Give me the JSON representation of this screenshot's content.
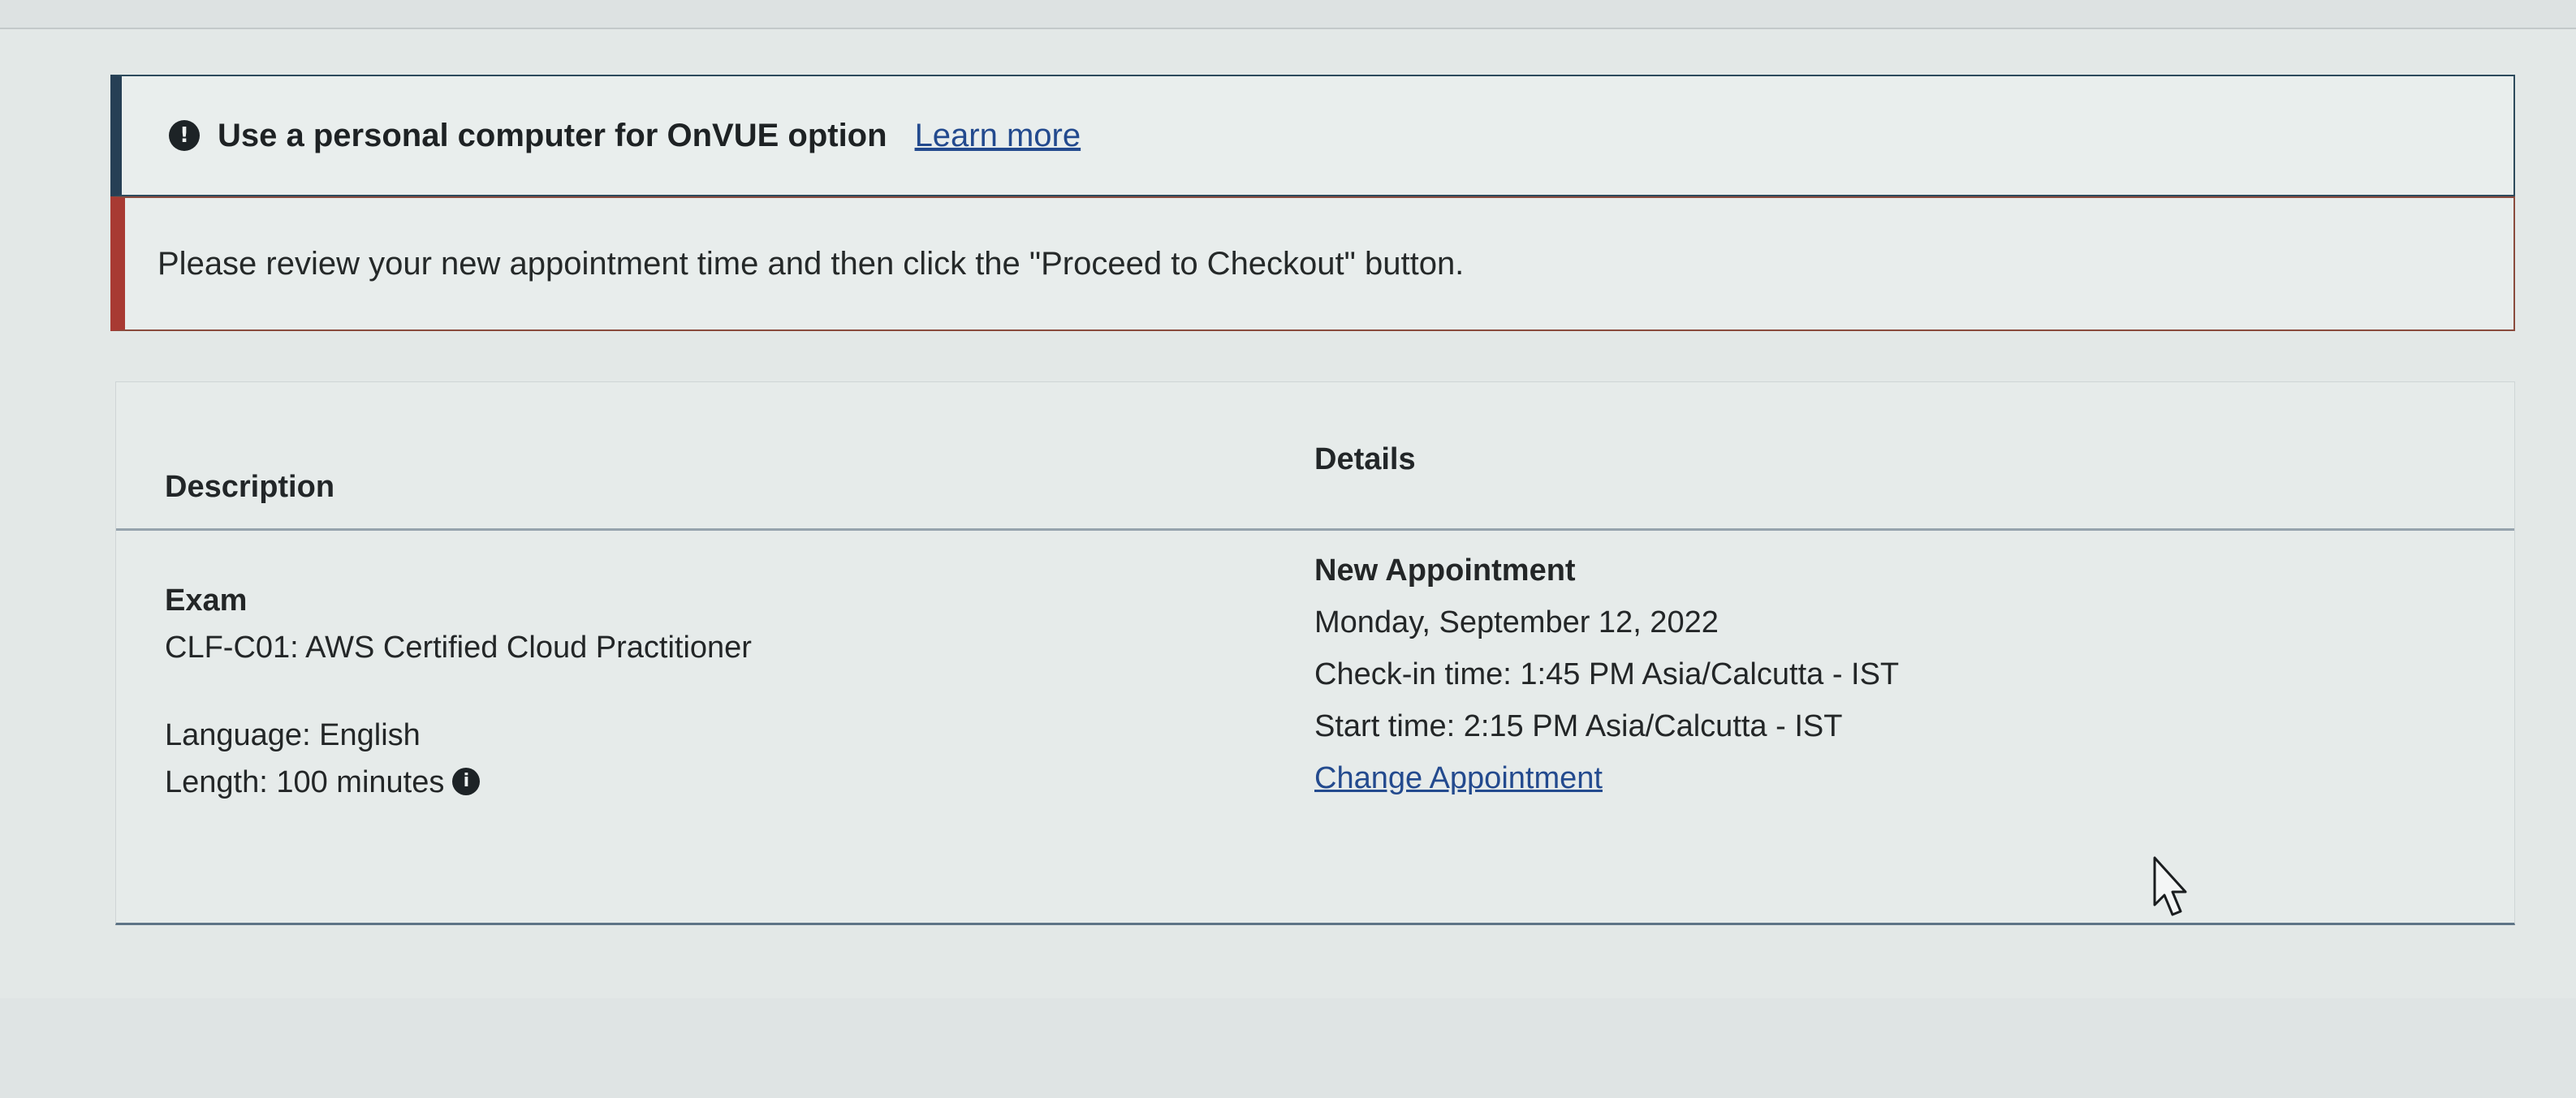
{
  "info_alert": {
    "icon": "info-circle-icon",
    "text": "Use a personal computer for OnVUE option",
    "link": "Learn more"
  },
  "warning_alert": {
    "text": "Please review your new appointment time and then click the \"Proceed to Checkout\" button."
  },
  "table": {
    "headers": {
      "description": "Description",
      "details": "Details"
    },
    "description": {
      "heading": "Exam",
      "exam_name": "CLF-C01: AWS Certified Cloud Practitioner",
      "language": "Language: English",
      "length": "Length: 100 minutes"
    },
    "details": {
      "heading": "New Appointment",
      "date": "Monday, September 12, 2022",
      "checkin": "Check-in time: 1:45 PM Asia/Calcutta - IST",
      "start": "Start time: 2:15 PM Asia/Calcutta - IST",
      "change_link": "Change Appointment"
    }
  }
}
